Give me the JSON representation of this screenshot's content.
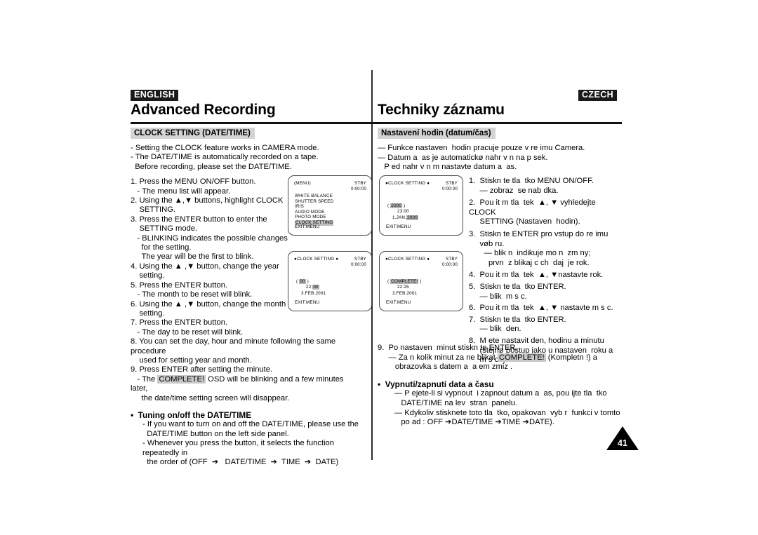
{
  "header": {
    "left_tag": "ENGLISH",
    "right_tag": "CZECH",
    "left_title": "Advanced Recording",
    "right_title": "Techniky záznamu"
  },
  "page_number": "41",
  "english": {
    "section_heading": "CLOCK SETTING (DATE/TIME)",
    "lines": [
      "- Setting the CLOCK feature works in CAMERA mode.",
      "- The DATE/TIME is automatically recorded on a tape.",
      "  Before recording, please set the DATE/TIME.",
      "",
      "1. Press the MENU ON/OFF button.",
      "   - The menu list will appear.",
      "2. Using the ▲,▼ buttons, highlight CLOCK",
      "    SETTING.",
      "3. Press the ENTER button to enter the",
      "    SETTING mode.",
      "   - BLINKING indicates the possible changes",
      "     for the setting.",
      "     The year will be the first to blink.",
      "4. Using the ▲ ,▼ button, change the year",
      "    setting.",
      "5. Press the ENTER button.",
      "   - The month to be reset will blink.",
      "6. Using the ▲ ,▼ button, change the month",
      "    setting.",
      "7. Press the ENTER button.",
      "   - The day to be reset will blink.",
      "8. You can set the day, hour and minute following the same procedure",
      "    used for setting year and month.",
      "9. Press ENTER after setting the minute."
    ],
    "complete_line_prefix": "   - The ",
    "complete_badge": "COMPLETE!",
    "complete_line_suffix": " OSD will be blinking and a few minutes later,",
    "complete_line_2": "     the date/time setting screen will disappear.",
    "bullet_heading": "•  Tuning on/off the DATE/TIME",
    "bullet_lines": [
      "- If you want to turn on and off the DATE/TIME, please use the",
      "  DATE/TIME button on the left side panel.",
      "- Whenever you press the button, it selects the function repeatedly in",
      "  the order of (OFF  ➔   DATE/TIME  ➔  TIME  ➔  DATE)"
    ]
  },
  "czech": {
    "section_heading": "Nastavení hodin (datum/čas)",
    "intro_lines": [
      "— Funkce nastaven  hodin pracuje pouze v re imu Camera.",
      "— Datum a  as je automatickø nahr v n na p sek.",
      "   P ed nahr v n m nastavte datum a  as."
    ],
    "steps": [
      "1.  Stiskn te tla  tko MENU ON/OFF.",
      "     — zobraz  se nab dka.",
      "2.  Pou it m tla  tek  ▲, ▼ vyhledejte CLOCK",
      "     SETTING (Nastaven  hodin).",
      "3.  Stiskn te ENTER pro vstup do re imu",
      "     vøb ru.",
      "       — blik n  indikuje mo n  zm ny;",
      "         prvn  z blikaj c ch  daj  je rok.",
      "4.  Pou it m tla  tek  ▲, ▼nastavte rok.",
      "5.  Stiskn te tla  tko ENTER.",
      "     — blik  m s c.",
      "6.  Pou it m tla  tek  ▲, ▼ nastavte m s c.",
      "7.  Stiskn te tla  tko ENTER.",
      "     — blik  den.",
      "8.  M ete nastavit den, hodinu a minutu",
      "     (stejnø postup jako u nastaven  roku a",
      "     m s ce).",
      "9.  Po nastaven  minut stiskn te ENTER."
    ],
    "complete_prefix": "     — Za n kolik minut za ne blikat ",
    "complete_badge": "COMPLETE!",
    "complete_suffix": " (Kompletn !) a",
    "complete_line_2": "        obrazovka s datem a  a em zmiz .",
    "bullet_heading": "•  Vypnutí/zapnutí data a času",
    "bullet_lines": [
      "— P ejete-li si vypnout  i zapnout datum a  as, pou ijte tla  tko",
      "   DATE/TIME na lev  stran  panelu.",
      "— Kdykoliv stisknete toto tla  tko, opakovan  vyb r  funkci v tomto",
      "   po ad : OFF ➔DATE/TIME ➔TIME ➔DATE)."
    ]
  },
  "lcd_menu": {
    "title": "(MENU)",
    "stby": "STBY",
    "timecode": "0:00:00",
    "items": [
      "WHITE BALANCE",
      "SHUTTER  SPEED",
      "IRIS",
      "AUDIO  MODE",
      "PHOTO  MODE",
      "CLOCK  SETTING"
    ],
    "selected_item": "CLOCK  SETTING",
    "exit": "EXIT:MENU"
  },
  "lcd_clock_en": {
    "title": "●CLOCK  SETTING ●",
    "stby": "STBY",
    "timecode": "0:00:00",
    "row1_open": "( ",
    "row1_value": "00",
    "row1_close": " )",
    "row2_pre": "22:",
    "row2_value": "00",
    "row3": "3.FEB.2001",
    "exit": "EXIT:MENU"
  },
  "lcd_clock_cz_top": {
    "title": "●CLOCK  SETTING ●",
    "stby": "STBY",
    "timecode": "0:00:00",
    "row1_open": "( ",
    "row1_value": "2000",
    "row1_close": " )",
    "row2_pre": "23:00",
    "row2_value": "",
    "row3_pre": "1.JAN.",
    "row3_value": "2000",
    "exit": "EXIT:MENU"
  },
  "lcd_clock_cz_bottom": {
    "title": "●CLOCK  SETTING ●",
    "stby": "STBY",
    "timecode": "0:00:00",
    "row1_open": "( ",
    "row1_value": "COMPLETE!",
    "row1_close": " )",
    "row2": "22:25",
    "row3": "3.FEB.2001",
    "exit": "EXIT:MENU"
  }
}
